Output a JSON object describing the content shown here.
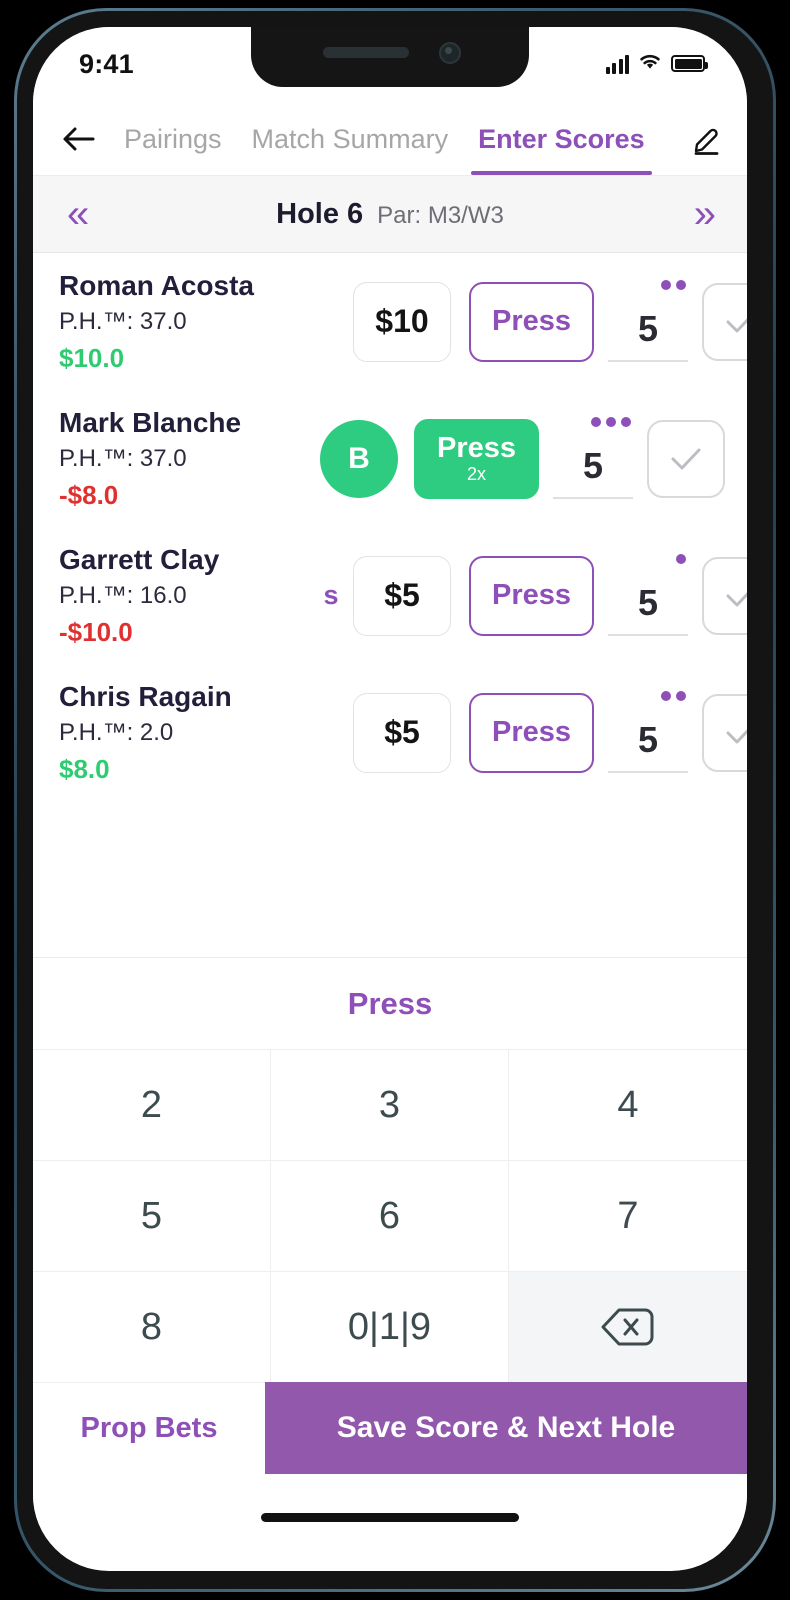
{
  "status_bar": {
    "time": "9:41",
    "signal_icon": "cellular-bars-icon",
    "wifi_icon": "wifi-icon",
    "battery_icon": "battery-full-icon"
  },
  "nav": {
    "back_icon": "back-arrow-icon",
    "edit_icon": "pencil-edit-icon",
    "tabs": [
      {
        "label": "Pairings",
        "active": false
      },
      {
        "label": "Match Summary",
        "active": false
      },
      {
        "label": "Enter Scores",
        "active": true
      }
    ]
  },
  "hole_bar": {
    "prev_icon": "double-chevron-left-icon",
    "next_icon": "double-chevron-right-icon",
    "hole_label": "Hole 6",
    "par_label": "Par: M3/W3"
  },
  "players": [
    {
      "name": "Roman Acosta",
      "handicap": "P.H.™: 37.0",
      "amount": "$10.0",
      "amount_sign": "pos",
      "marker": "",
      "badge": null,
      "bet": "$10",
      "press": {
        "label": "Press",
        "sub": "",
        "style": "outline"
      },
      "score": "5",
      "dots": 2,
      "check_icon": "checkmark-icon"
    },
    {
      "name": "Mark Blanche",
      "handicap": "P.H.™: 37.0",
      "amount": "-$8.0",
      "amount_sign": "neg",
      "marker": "",
      "badge": "B",
      "bet": null,
      "press": {
        "label": "Press",
        "sub": "2x",
        "style": "filled"
      },
      "score": "5",
      "dots": 3,
      "check_icon": "checkmark-icon"
    },
    {
      "name": "Garrett Clay",
      "handicap": "P.H.™: 16.0",
      "amount": "-$10.0",
      "amount_sign": "neg",
      "marker": "s",
      "badge": null,
      "bet": "$5",
      "press": {
        "label": "Press",
        "sub": "",
        "style": "outline"
      },
      "score": "5",
      "dots": 1,
      "check_icon": "checkmark-icon"
    },
    {
      "name": "Chris Ragain",
      "handicap": "P.H.™: 2.0",
      "amount": "$8.0",
      "amount_sign": "pos",
      "marker": "",
      "badge": null,
      "bet": "$5",
      "press": {
        "label": "Press",
        "sub": "",
        "style": "outline"
      },
      "score": "5",
      "dots": 2,
      "check_icon": "checkmark-icon"
    }
  ],
  "press_strip": {
    "label": "Press"
  },
  "keypad": {
    "keys": [
      {
        "label": "2",
        "type": "digit"
      },
      {
        "label": "3",
        "type": "digit"
      },
      {
        "label": "4",
        "type": "digit"
      },
      {
        "label": "5",
        "type": "digit"
      },
      {
        "label": "6",
        "type": "digit"
      },
      {
        "label": "7",
        "type": "digit"
      },
      {
        "label": "8",
        "type": "digit"
      },
      {
        "label": "0|1|9",
        "type": "multi"
      },
      {
        "label": "",
        "type": "backspace",
        "icon": "backspace-icon"
      }
    ]
  },
  "actions": {
    "prop_bets_label": "Prop Bets",
    "save_label": "Save Score & Next Hole"
  },
  "colors": {
    "accent_purple": "#8e4fb8",
    "save_purple": "#9158ac",
    "positive_green": "#2ecc71",
    "badge_green": "#2ecc80",
    "negative_red": "#e03131",
    "muted_gray": "#a6a6a6"
  }
}
